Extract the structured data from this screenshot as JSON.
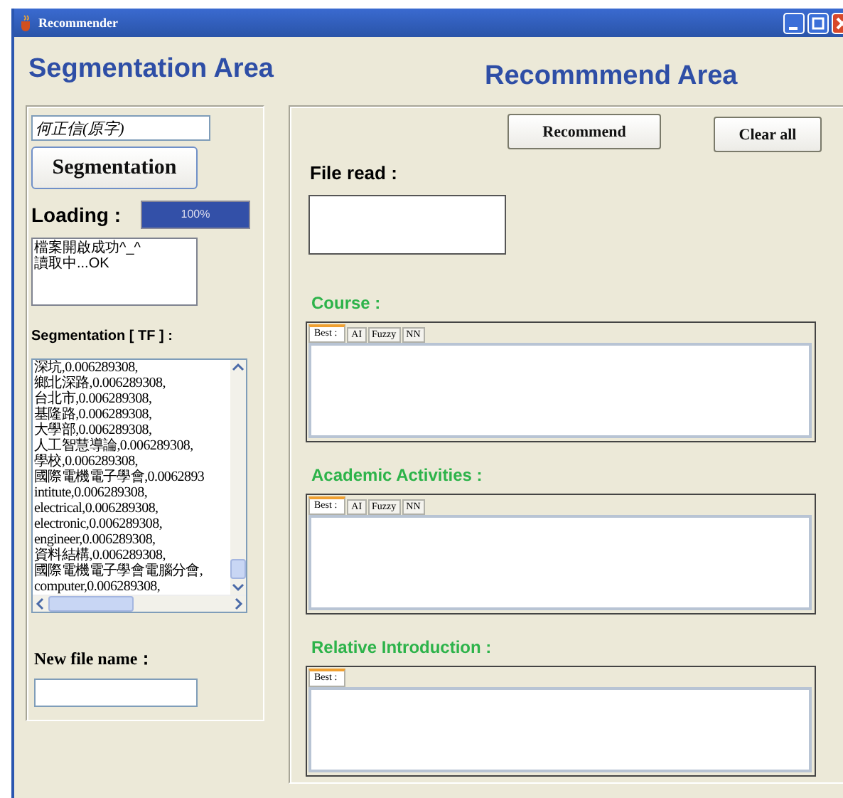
{
  "window": {
    "title": "Recommender"
  },
  "segmentation_area": {
    "heading": "Segmentation Area",
    "name_field": {
      "value": "何正信(原字)"
    },
    "segment_button": "Segmentation",
    "loading": {
      "label": "Loading :",
      "level": 1,
      "reading": "100%"
    },
    "log": [
      "檔案開啟成功^_^",
      "讀取中...OK"
    ],
    "tf_label": "Segmentation [ TF ] :",
    "tf_list": [
      "深坑,0.006289308,",
      "鄉北深路,0.006289308,",
      "台北市,0.006289308,",
      "基隆路,0.006289308,",
      "大學部,0.006289308,",
      "人工智慧導論,0.006289308,",
      "學校,0.006289308,",
      "國際電機電子學會,0.0062893",
      "intitute,0.006289308,",
      "electrical,0.006289308,",
      "electronic,0.006289308,",
      "engineer,0.006289308,",
      "資料結構,0.006289308,",
      "國際電機電子學會電腦分會,",
      "computer,0.006289308,"
    ],
    "new_file": {
      "label": "New file name："
    }
  },
  "recommend_area": {
    "heading": "Recommmend Area",
    "buttons": [
      "Recommend",
      "Clear all"
    ],
    "file_read": {
      "label": "File read :"
    },
    "sections": [
      {
        "title": "Course :",
        "tabs": [
          {
            "label": "Best :",
            "selected": true
          },
          {
            "label": "AI",
            "selected": false
          },
          {
            "label": "Fuzzy",
            "selected": false
          },
          {
            "label": "NN",
            "selected": false
          }
        ]
      },
      {
        "title": "Academic Activities :",
        "tabs": [
          {
            "label": "Best :",
            "selected": true
          },
          {
            "label": "AI",
            "selected": false
          },
          {
            "label": "Fuzzy",
            "selected": false
          },
          {
            "label": "NN",
            "selected": false
          }
        ]
      },
      {
        "title": "Relative Introduction :",
        "tabs": [
          {
            "label": "Best :",
            "selected": true
          }
        ]
      }
    ]
  }
}
